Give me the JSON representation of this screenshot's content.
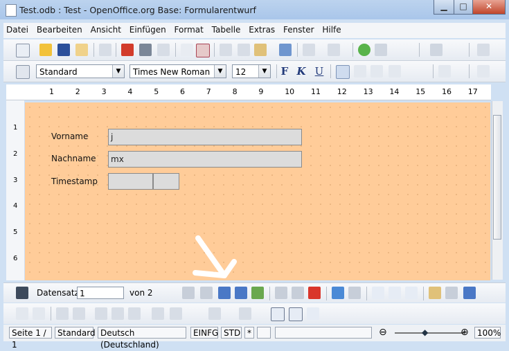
{
  "window": {
    "title": "Test.odb : Test - OpenOffice.org Base: Formularentwurf"
  },
  "menu": [
    "Datei",
    "Bearbeiten",
    "Ansicht",
    "Einfügen",
    "Format",
    "Tabelle",
    "Extras",
    "Fenster",
    "Hilfe"
  ],
  "format_toolbar": {
    "paragraph_style": "Standard",
    "font_name": "Times New Roman",
    "font_size": "12",
    "bold": "F",
    "italic": "K",
    "underline": "U"
  },
  "ruler": {
    "ticks": [
      "1",
      "2",
      "3",
      "4",
      "5",
      "6",
      "7",
      "8",
      "9",
      "10",
      "11",
      "12",
      "13",
      "14",
      "15",
      "16",
      "17"
    ],
    "left_ticks": [
      "1",
      "2",
      "3",
      "4",
      "5",
      "6"
    ]
  },
  "form": {
    "fields": [
      {
        "label": "Vorname",
        "value": "j"
      },
      {
        "label": "Nachname",
        "value": "mx"
      },
      {
        "label": "Timestamp",
        "value": ""
      }
    ]
  },
  "navigation": {
    "record_label": "Datensatz",
    "record_value": "1",
    "of_label": "von 2"
  },
  "status": {
    "page": "Seite 1 / 1",
    "style": "Standard",
    "language": "Deutsch (Deutschland)",
    "mode": "EINFG",
    "selection": "STD",
    "modified": "*",
    "zoom": "100%"
  },
  "colors": {
    "form_background": "#ffcc99",
    "title_bar": "#bcd3ee"
  }
}
